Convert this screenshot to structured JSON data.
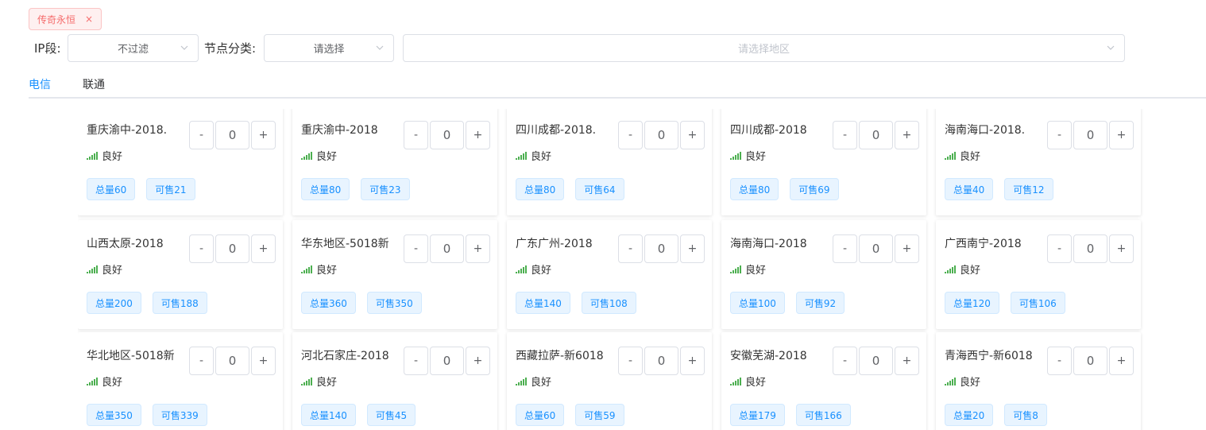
{
  "filter_tag": {
    "label": "传奇永恒",
    "close": "×"
  },
  "filters": {
    "ip_label": "IP段:",
    "ip_value": "不过滤",
    "node_label": "节点分类:",
    "node_value": "请选择",
    "region_placeholder": "请选择地区"
  },
  "tabs": [
    {
      "label": "电信",
      "active": true
    },
    {
      "label": "联通",
      "active": false
    }
  ],
  "signal_label": "良好",
  "stepper": {
    "minus": "-",
    "plus": "+",
    "value": "0"
  },
  "cards": [
    {
      "name": "重庆渝中-2018.",
      "total": "总量60",
      "avail": "可售21"
    },
    {
      "name": "重庆渝中-2018",
      "total": "总量80",
      "avail": "可售23"
    },
    {
      "name": "四川成都-2018.",
      "total": "总量80",
      "avail": "可售64"
    },
    {
      "name": "四川成都-2018",
      "total": "总量80",
      "avail": "可售69"
    },
    {
      "name": "海南海口-2018.",
      "total": "总量40",
      "avail": "可售12"
    },
    {
      "name": "山西太原-2018",
      "total": "总量200",
      "avail": "可售188"
    },
    {
      "name": "华东地区-5018新",
      "total": "总量360",
      "avail": "可售350"
    },
    {
      "name": "广东广州-2018",
      "total": "总量140",
      "avail": "可售108"
    },
    {
      "name": "海南海口-2018",
      "total": "总量100",
      "avail": "可售92"
    },
    {
      "name": "广西南宁-2018",
      "total": "总量120",
      "avail": "可售106"
    },
    {
      "name": "华北地区-5018新",
      "total": "总量350",
      "avail": "可售339"
    },
    {
      "name": "河北石家庄-2018",
      "total": "总量140",
      "avail": "可售45"
    },
    {
      "name": "西藏拉萨-新6018",
      "total": "总量60",
      "avail": "可售59"
    },
    {
      "name": "安徽芜湖-2018",
      "total": "总量179",
      "avail": "可售166"
    },
    {
      "name": "青海西宁-新6018",
      "total": "总量20",
      "avail": "可售8"
    }
  ]
}
